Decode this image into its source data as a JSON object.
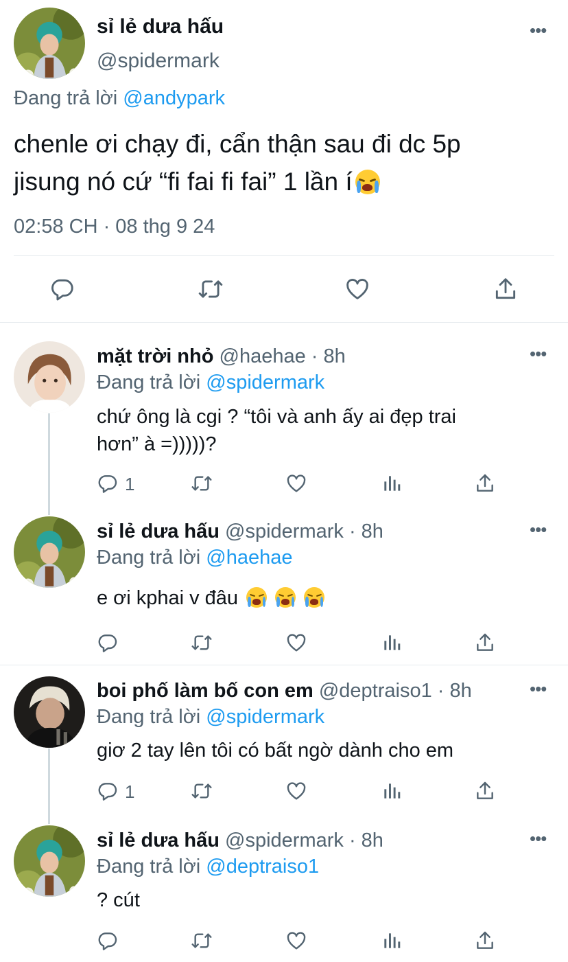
{
  "main_tweet": {
    "display_name": "sỉ lẻ dưa hấu",
    "handle": "@spidermark",
    "replying_prefix": "Đang trả lời",
    "replying_to": "@andypark",
    "text_line1": "chenle ơi chạy đi, cẩn thận sau đi dc 5p",
    "text_line2": "jisung nó cứ “fi fai fi fai” 1 lần í",
    "emoji": "loudly-crying-face",
    "timestamp": "02:58 CH · 08 thg 9 24",
    "actions": [
      "reply-icon",
      "retweet-icon",
      "like-icon",
      "share-icon"
    ]
  },
  "replies": [
    {
      "display_name": "mặt trời nhỏ",
      "handle": "@haehae",
      "time": "· 8h",
      "replying_prefix": "Đang trả lời",
      "replying_to": "@spidermark",
      "text_line1": "chứ ông là cgi ? “tôi và anh ấy ai đẹp trai",
      "text_line2": "hơn” à =)))))?",
      "reply_count": "1"
    },
    {
      "display_name": "sỉ lẻ dưa hấu",
      "handle": "@spidermark",
      "time": "· 8h",
      "replying_prefix": "Đang trả lời",
      "replying_to": "@haehae",
      "text_line1": "e ơi kphai v đâu",
      "reply_count": ""
    },
    {
      "display_name": "boi phố làm bố con em",
      "handle": "@deptraiso1",
      "time": "· 8h",
      "replying_prefix": "Đang trả lời",
      "replying_to": "@spidermark",
      "text_line1": "giơ 2 tay lên tôi có bất ngờ dành cho em",
      "reply_count": "1"
    },
    {
      "display_name": "sỉ lẻ dưa hấu",
      "handle": "@spidermark",
      "time": "· 8h",
      "replying_prefix": "Đang trả lời",
      "replying_to": "@deptraiso1",
      "text_line1": "? cút",
      "reply_count": ""
    }
  ],
  "colors": {
    "link": "#1d9bf0",
    "muted": "#536471",
    "text": "#0f1419",
    "divider": "#e6ebee"
  }
}
